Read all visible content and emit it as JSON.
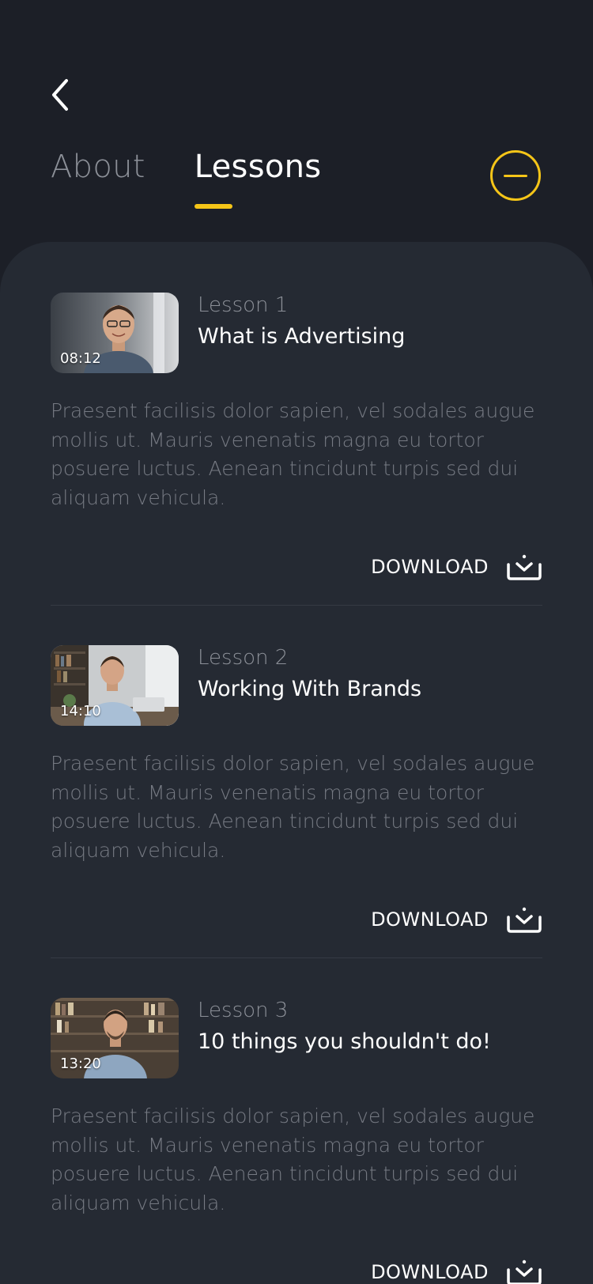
{
  "tabs": [
    {
      "label": "About",
      "active": false
    },
    {
      "label": "Lessons",
      "active": true
    }
  ],
  "accent_color": "#f5c518",
  "icons": {
    "back": "chevron-left-icon",
    "collapse": "minus-circle-icon",
    "download": "download-tray-icon"
  },
  "lessons": [
    {
      "number": "Lesson 1",
      "title": "What is Advertising",
      "duration": "08:12",
      "description": "Praesent facilisis dolor sapien, vel sodales augue mollis ut. Mauris venenatis magna eu tortor posuere luctus. Aenean tincidunt turpis sed dui aliquam vehicula.",
      "download_label": "DOWNLOAD"
    },
    {
      "number": "Lesson 2",
      "title": "Working With Brands",
      "duration": "14:10",
      "description": "Praesent facilisis dolor sapien, vel sodales augue mollis ut. Mauris venenatis magna eu tortor posuere luctus. Aenean tincidunt turpis sed dui aliquam vehicula.",
      "download_label": "DOWNLOAD"
    },
    {
      "number": "Lesson 3",
      "title": "10 things you shouldn't do!",
      "duration": "13:20",
      "description": "Praesent facilisis dolor sapien, vel sodales augue mollis ut. Mauris venenatis magna eu tortor posuere luctus. Aenean tincidunt turpis sed dui aliquam vehicula.",
      "download_label": "DOWNLOAD"
    }
  ]
}
